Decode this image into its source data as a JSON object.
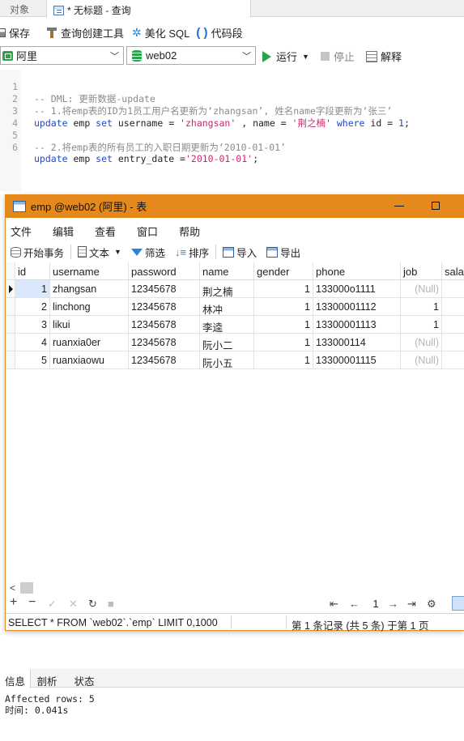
{
  "tabs": {
    "objects": "对象",
    "query": "* 无标题 - 查询"
  },
  "toolbar": {
    "save": "保存",
    "query_builder": "查询创建工具",
    "beautify": "美化 SQL",
    "snippet": "代码段"
  },
  "connection": {
    "name": "阿里",
    "database": "web02",
    "run": "运行",
    "stop": "停止",
    "explain": "解释"
  },
  "editor": {
    "line_numbers": [
      "1",
      "2",
      "3",
      "4",
      "5",
      "6"
    ],
    "line1": "-- DML: 更新数据-update",
    "line2": "-- 1.将emp表的ID为1员工用户名更新为‘zhangsan’, 姓名name字段更新为‘张三’",
    "line3": {
      "k1": "update",
      "t1": " emp ",
      "k2": "set",
      "t2": " username = ",
      "s1": "'zhangsan'",
      "t3": " , name = ",
      "s2": "'荆之楠'",
      "t4": " ",
      "k3": "where",
      "t5": " id = ",
      "n1": "1",
      "t6": ";"
    },
    "line5": "-- 2.将emp表的所有员工的入职日期更新为‘2010-01-01’",
    "line6": {
      "k1": "update",
      "t1": " emp ",
      "k2": "set",
      "t2": " entry_date =",
      "s1": "'2010-01-01'",
      "t3": ";"
    }
  },
  "result_window": {
    "title": "emp @web02 (阿里) - 表",
    "menu": [
      "文件",
      "编辑",
      "查看",
      "窗口",
      "帮助"
    ],
    "toolbar": {
      "begin_tx": "开始事务",
      "text": "文本",
      "filter": "筛选",
      "sort": "排序",
      "import": "导入",
      "export": "导出"
    },
    "columns": [
      "id",
      "username",
      "password",
      "name",
      "gender",
      "phone",
      "job",
      "salar"
    ],
    "rows": [
      [
        "1",
        "zhangsan",
        "12345678",
        "荆之楠",
        "1",
        "133000o1111",
        "(Null)",
        ""
      ],
      [
        "2",
        "linchong",
        "12345678",
        "林冲",
        "1",
        "13300001112",
        "1",
        ""
      ],
      [
        "3",
        "likui",
        "12345678",
        "李逵",
        "1",
        "13300001113",
        "1",
        ""
      ],
      [
        "4",
        "ruanxia0er",
        "12345678",
        "阮小二",
        "1",
        "133000114",
        "(Null)",
        ""
      ],
      [
        "5",
        "ruanxiaowu",
        "12345678",
        "阮小五",
        "1",
        "13300001115",
        "(Null)",
        ""
      ]
    ],
    "page": "1",
    "status_sql": "SELECT * FROM `web02`.`emp` LIMIT 0,1000",
    "status_info": "第 1 条记录 (共 5 条) 于第 1 页"
  },
  "bottom": {
    "tabs": [
      "信息",
      "剖析",
      "状态"
    ],
    "log_line1": "Affected rows: 5",
    "log_line2": "时间: 0.041s"
  }
}
